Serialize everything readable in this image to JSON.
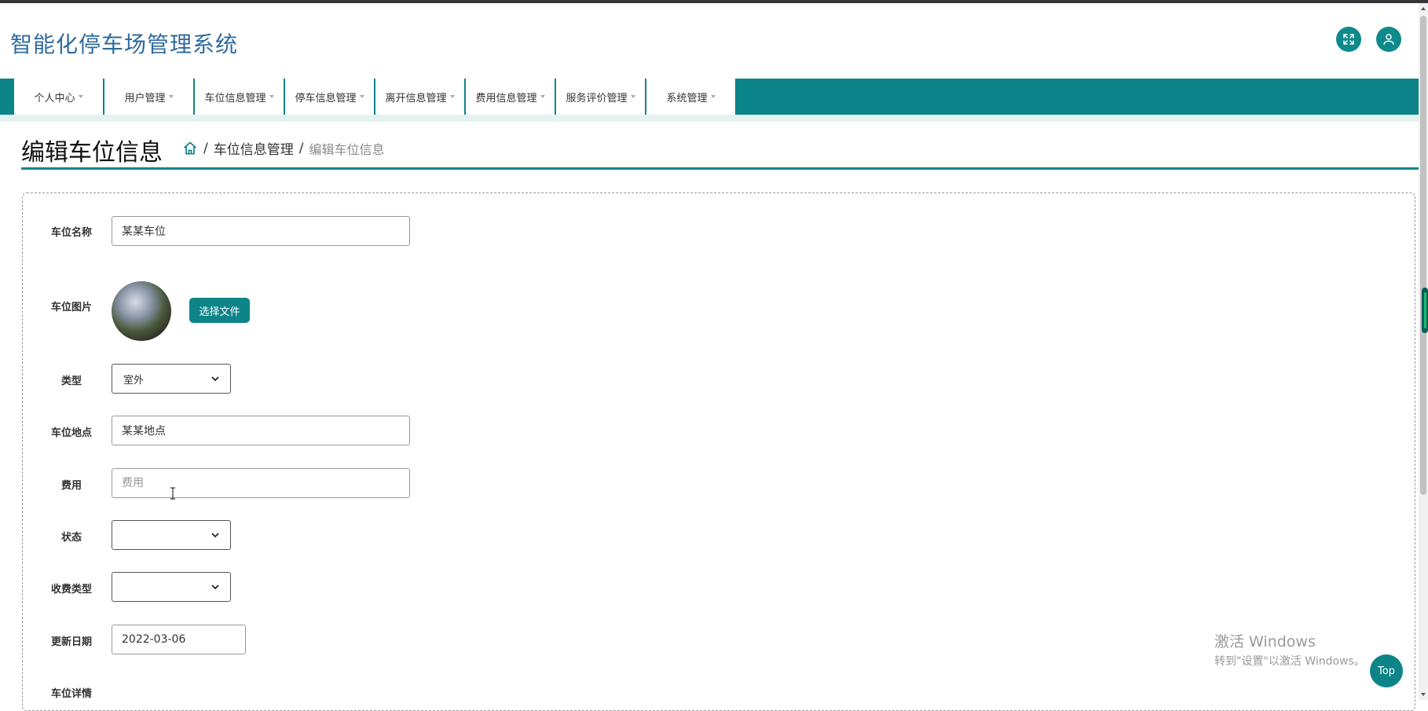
{
  "header": {
    "app_title": "智能化停车场管理系统",
    "fullscreen_icon": "expand-arrows-icon",
    "user_icon": "user-icon"
  },
  "nav": {
    "items": [
      {
        "label": "个人中心"
      },
      {
        "label": "用户管理"
      },
      {
        "label": "车位信息管理"
      },
      {
        "label": "停车信息管理"
      },
      {
        "label": "离开信息管理"
      },
      {
        "label": "费用信息管理"
      },
      {
        "label": "服务评价管理"
      },
      {
        "label": "系统管理"
      }
    ]
  },
  "page": {
    "title": "编辑车位信息",
    "breadcrumb": {
      "home_icon": "home-icon",
      "level1": "车位信息管理",
      "current": "编辑车位信息",
      "separator": "/"
    }
  },
  "form": {
    "name": {
      "label": "车位名称",
      "value": "某某车位"
    },
    "image": {
      "label": "车位图片",
      "button": "选择文件"
    },
    "type": {
      "label": "类型",
      "value": "室外"
    },
    "location": {
      "label": "车位地点",
      "value": "某某地点"
    },
    "fee": {
      "label": "费用",
      "value": "",
      "placeholder": "费用"
    },
    "status": {
      "label": "状态",
      "value": ""
    },
    "charge_type": {
      "label": "收费类型",
      "value": ""
    },
    "update_date": {
      "label": "更新日期",
      "value": "2022-03-06"
    },
    "details": {
      "label": "车位详情"
    }
  },
  "overlay": {
    "watermark_line1": "激活 Windows",
    "watermark_line2": "转到\"设置\"以激活 Windows。",
    "top_button": "Top"
  },
  "colors": {
    "accent": "#0d8488",
    "title_blue": "#2e6a9e",
    "nav_strip": "#e4f2f1"
  }
}
